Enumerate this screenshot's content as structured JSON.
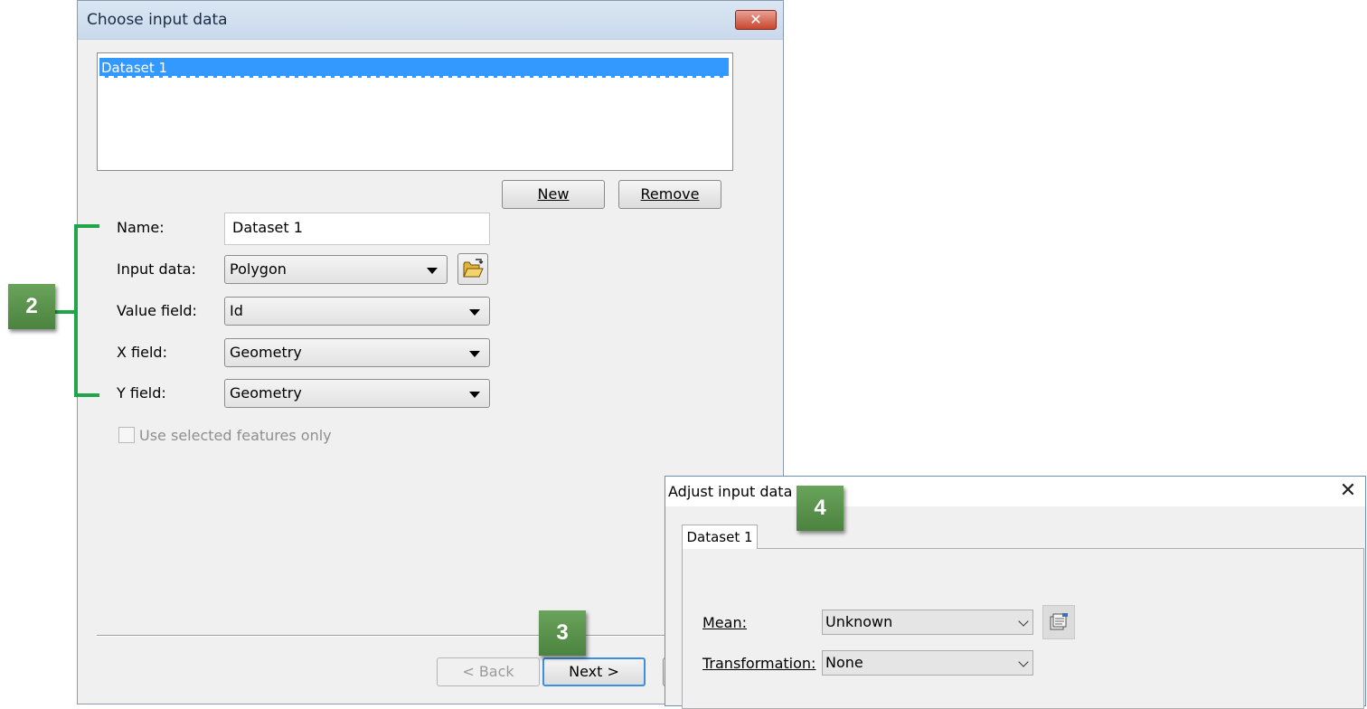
{
  "choose_dialog": {
    "title": "Choose input data",
    "close_glyph": "✕",
    "datasets": [
      "Dataset 1"
    ],
    "new_button": "New",
    "remove_button": "Remove",
    "name": {
      "label": "Name:",
      "value": "Dataset 1"
    },
    "input_data": {
      "label": "Input data:",
      "value": "Polygon"
    },
    "value_field": {
      "label": "Value field:",
      "value": "Id"
    },
    "x_field": {
      "label": "X field:",
      "value": "Geometry"
    },
    "y_field": {
      "label": "Y field:",
      "value": "Geometry"
    },
    "use_selected": "Use selected features only",
    "back_button": "< Back",
    "next_button": "Next >"
  },
  "adjust_dialog": {
    "title": "Adjust input data",
    "close_glyph": "✕",
    "tab": "Dataset 1",
    "mean": {
      "label": "Mean:",
      "value": "Unknown"
    },
    "transformation": {
      "label": "Transformation:",
      "value": "None"
    }
  },
  "callouts": [
    "2",
    "3",
    "4"
  ],
  "colors": {
    "callout_green": "#5a9450",
    "bracket_green": "#1fa54a",
    "selection_blue": "#3399ff"
  },
  "icons": {
    "open_folder": "folder-open-icon",
    "properties": "properties-icon"
  }
}
